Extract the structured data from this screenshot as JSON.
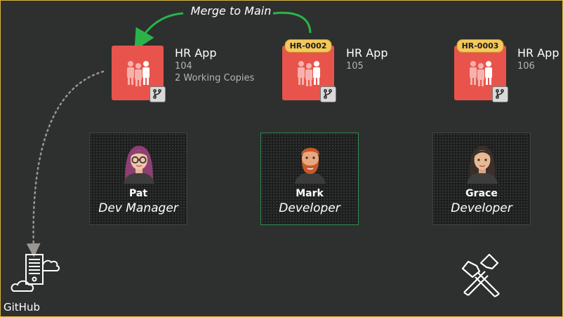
{
  "merge_label": "Merge to Main",
  "apps": [
    {
      "name": "HR App",
      "id": "104",
      "note": "2 Working Copies",
      "ticket": ""
    },
    {
      "name": "HR App",
      "id": "105",
      "note": "",
      "ticket": "HR-0002"
    },
    {
      "name": "HR App",
      "id": "106",
      "note": "",
      "ticket": "HR-0003"
    }
  ],
  "people": [
    {
      "name": "Pat",
      "role": "Dev Manager"
    },
    {
      "name": "Mark",
      "role": "Developer"
    },
    {
      "name": "Grace",
      "role": "Developer"
    }
  ],
  "github_label": "GitHub",
  "colors": {
    "background": "#2d302e",
    "tile": "#e8544c",
    "ticket": "#f4c95a",
    "merge_arrow": "#2bb34a",
    "active_border": "#2e8a4e"
  },
  "icons": [
    "people-icon",
    "branch-icon",
    "github-server-icon",
    "hammer-tools-icon"
  ]
}
